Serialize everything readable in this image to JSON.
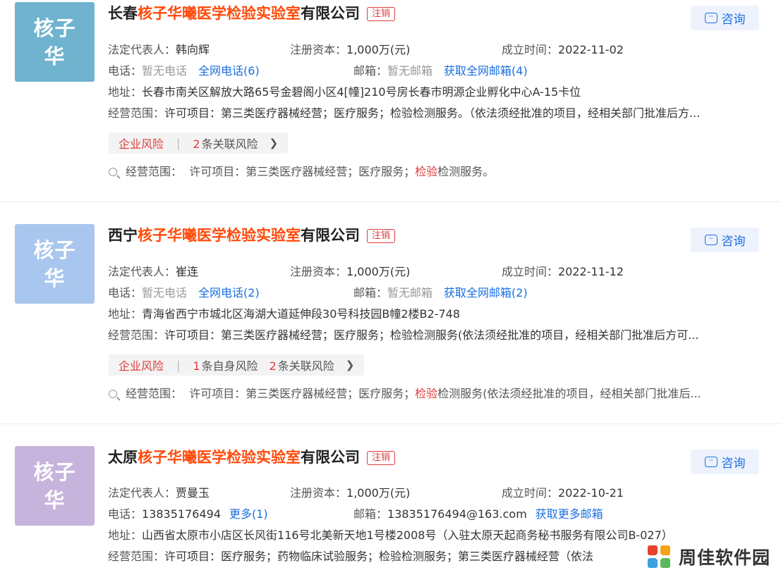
{
  "labels": {
    "legal_rep": "法定代表人：",
    "capital": "注册资本：",
    "founded": "成立时间：",
    "phone": "电话：",
    "email": "邮箱：",
    "address": "地址：",
    "scope": "经营范围：",
    "scope_match": "经营范围：",
    "consult": "咨询",
    "risk": "企业风险",
    "risk_sep": "|"
  },
  "companies": [
    {
      "logo_text": "核子华",
      "logo_color": "#6fb3cf",
      "name_prefix": "长春",
      "name_highlight": "核子华曦医学检验实验室",
      "name_suffix": "有限公司",
      "status": "注销",
      "legal_rep": "韩向辉",
      "capital": "1,000万(元)",
      "founded": "2022-11-02",
      "phone": "暂无电话",
      "phone_link": "全网电话(6)",
      "email": "暂无邮箱",
      "email_link": "获取全网邮箱(4)",
      "address": "长春市南关区解放大路65号金碧阁小区4[幢]210号房长春市明源企业孵化中心A-15卡位",
      "scope": "许可项目：第三类医疗器械经营；医疗服务；检验检测服务。（依法须经批准的项目，经相关部门批准后方...",
      "risks": [
        {
          "num": "2",
          "text": "条关联风险"
        }
      ],
      "match_before": "许可项目：第三类医疗器械经营；医疗服务；",
      "match_kw": "检验",
      "match_after": "检测服务。"
    },
    {
      "logo_text": "核子华",
      "logo_color": "#a9c6ee",
      "name_prefix": "西宁",
      "name_highlight": "核子华曦医学检验实验室",
      "name_suffix": "有限公司",
      "status": "注销",
      "legal_rep": "崔连",
      "capital": "1,000万(元)",
      "founded": "2022-11-12",
      "phone": "暂无电话",
      "phone_link": "全网电话(2)",
      "email": "暂无邮箱",
      "email_link": "获取全网邮箱(2)",
      "address": "青海省西宁市城北区海湖大道延伸段30号科技园B幢2楼B2-748",
      "scope": "许可项目：第三类医疗器械经营；医疗服务；检验检测服务(依法须经批准的项目，经相关部门批准后方可...",
      "risks": [
        {
          "num": "1",
          "text": "条自身风险"
        },
        {
          "num": "2",
          "text": "条关联风险"
        }
      ],
      "match_before": "许可项目：第三类医疗器械经营；医疗服务；",
      "match_kw": "检验",
      "match_after": "检测服务(依法须经批准的项目，经相关部门批准后..."
    },
    {
      "logo_text": "核子华",
      "logo_color": "#c7b4dc",
      "name_prefix": "太原",
      "name_highlight": "核子华曦医学检验实验室",
      "name_suffix": "有限公司",
      "status": "注销",
      "legal_rep": "贾曼玉",
      "capital": "1,000万(元)",
      "founded": "2022-10-21",
      "phone": "13835176494",
      "phone_link": "更多(1)",
      "email": "13835176494@163.com",
      "email_link": "获取更多邮箱",
      "address": "山西省太原市小店区长风街116号北美新天地1号楼2008号（入驻太原天起商务秘书服务有限公司B-027）",
      "scope": "许可项目：医疗服务；药物临床试验服务；检验检测服务；第三类医疗器械经营（依法"
    }
  ],
  "watermark": {
    "text": "周佳软件园",
    "colors": [
      "#e8412c",
      "#f6a21a",
      "#3aa0e0",
      "#5bb85c"
    ]
  }
}
